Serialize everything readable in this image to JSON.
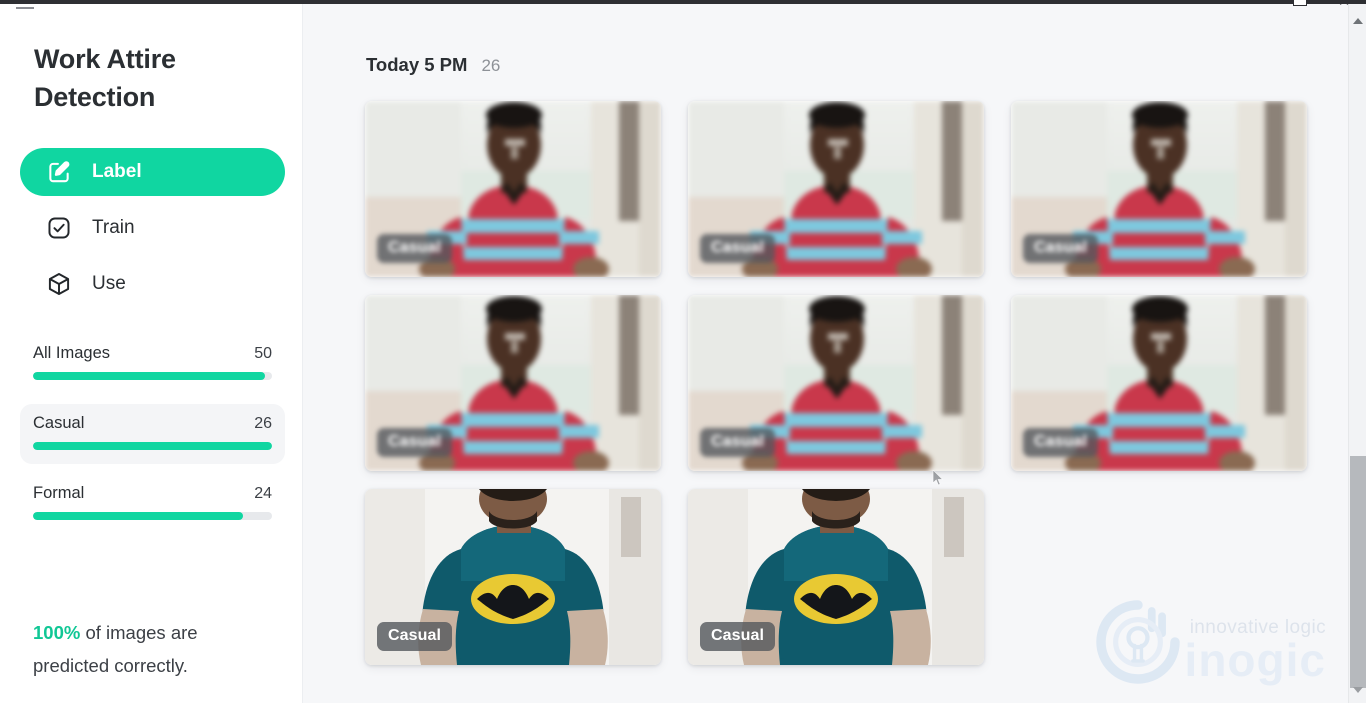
{
  "window": {
    "minimize_icon": "minimize-icon",
    "restore_icon": "restore-icon",
    "close_label": "✕"
  },
  "sidebar": {
    "title": "Work Attire Detection",
    "nav": [
      {
        "label": "Label",
        "icon": "pencil-square-icon",
        "active": true
      },
      {
        "label": "Train",
        "icon": "check-square-icon",
        "active": false
      },
      {
        "label": "Use",
        "icon": "cube-icon",
        "active": false
      }
    ],
    "stats": [
      {
        "name": "All Images",
        "count": "50",
        "percent": 97,
        "selected": false
      },
      {
        "name": "Casual",
        "count": "26",
        "percent": 100,
        "selected": true
      },
      {
        "name": "Formal",
        "count": "24",
        "percent": 88,
        "selected": false
      }
    ],
    "accuracy": {
      "percent": "100%",
      "text": " of images are predicted correctly."
    }
  },
  "main": {
    "group": {
      "title": "Today 5 PM",
      "count": "26"
    },
    "cards": [
      {
        "badge": "Casual",
        "scene": "red-stripe-shirt",
        "blurred": true
      },
      {
        "badge": "Casual",
        "scene": "red-stripe-shirt",
        "blurred": true
      },
      {
        "badge": "Casual",
        "scene": "red-stripe-shirt",
        "blurred": true
      },
      {
        "badge": "Casual",
        "scene": "red-stripe-shirt",
        "blurred": true
      },
      {
        "badge": "Casual",
        "scene": "red-stripe-shirt",
        "blurred": true
      },
      {
        "badge": "Casual",
        "scene": "red-stripe-shirt",
        "blurred": true
      },
      {
        "badge": "Casual",
        "scene": "batman-tshirt",
        "blurred": false
      },
      {
        "badge": "Casual",
        "scene": "batman-tshirt",
        "blurred": false
      }
    ]
  },
  "watermark": {
    "tagline": "innovative logic",
    "name": "inogic"
  },
  "colors": {
    "accent": "#10d6a1",
    "accent_text": "#10c795",
    "text": "#2b2f33",
    "muted": "#8d9197",
    "panel": "#ffffff",
    "canvas": "#f6f7f9",
    "badge_bg": "rgba(84,88,92,0.80)"
  }
}
